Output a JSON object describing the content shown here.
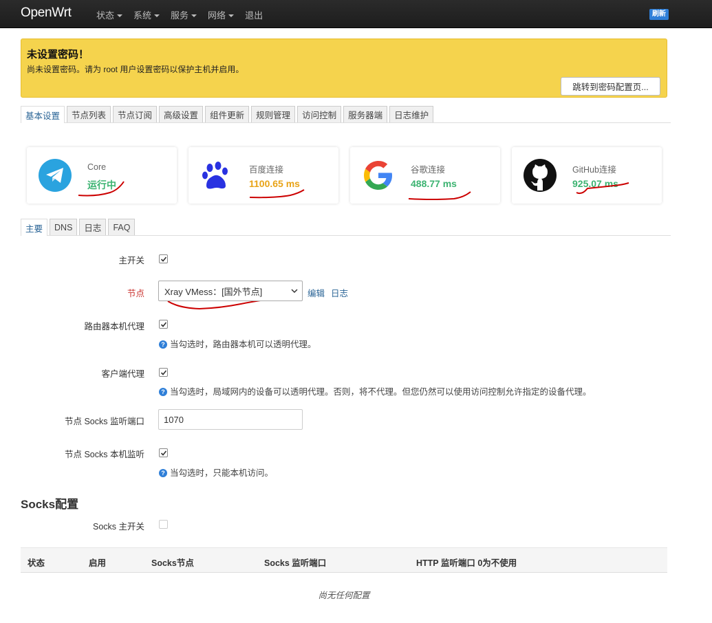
{
  "navbar": {
    "brand": "OpenWrt",
    "menu": [
      "状态",
      "系统",
      "服务",
      "网络"
    ],
    "logout": "退出",
    "refresh": "刷新"
  },
  "alert": {
    "title": "未设置密码！",
    "text": "尚未设置密码。请为 root 用户设置密码以保护主机并启用。",
    "button": "跳转到密码配置页..."
  },
  "main_tabs": [
    "基本设置",
    "节点列表",
    "节点订阅",
    "高级设置",
    "组件更新",
    "规则管理",
    "访问控制",
    "服务器端",
    "日志维护"
  ],
  "cards": [
    {
      "label": "Core",
      "value": "运行中",
      "icon": "telegram-icon",
      "color": "#3cb371"
    },
    {
      "label": "百度连接",
      "value": "1100.65 ms",
      "icon": "baidu-paw-icon",
      "color": "#e8a317"
    },
    {
      "label": "谷歌连接",
      "value": "488.77 ms",
      "icon": "google-icon",
      "color": "#3cb371"
    },
    {
      "label": "GitHub连接",
      "value": "925.07 ms",
      "icon": "github-icon",
      "color": "#3cb371"
    }
  ],
  "sub_tabs": [
    "主要",
    "DNS",
    "日志",
    "FAQ"
  ],
  "form": {
    "main_switch": {
      "label": "主开关",
      "checked": true
    },
    "node": {
      "label": "节点",
      "value": "Xray VMess：[国外节点]",
      "edit": "编辑",
      "log": "日志"
    },
    "router_proxy": {
      "label": "路由器本机代理",
      "checked": true,
      "help": "当勾选时，路由器本机可以透明代理。"
    },
    "client_proxy": {
      "label": "客户端代理",
      "checked": true,
      "help": "当勾选时，局域网内的设备可以透明代理。否则，将不代理。但您仍然可以使用访问控制允许指定的设备代理。"
    },
    "socks_port": {
      "label": "节点 Socks 监听端口",
      "value": "1070"
    },
    "socks_local": {
      "label": "节点 Socks 本机监听",
      "checked": true,
      "help": "当勾选时，只能本机访问。"
    }
  },
  "socks": {
    "title": "Socks配置",
    "switch_label": "Socks 主开关",
    "switch_checked": false,
    "columns": [
      "状态",
      "启用",
      "Socks节点",
      "Socks 监听端口",
      "HTTP 监听端口 0为不使用"
    ],
    "empty": "尚无任何配置"
  }
}
